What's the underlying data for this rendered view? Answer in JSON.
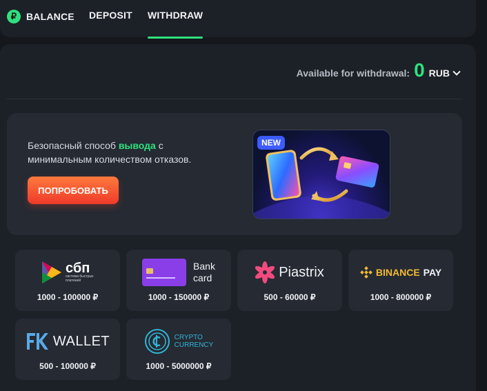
{
  "nav": {
    "logo_symbol": "₽",
    "tabs": [
      {
        "label": "BALANCE"
      },
      {
        "label": "DEPOSIT"
      },
      {
        "label": "WITHDRAW"
      }
    ],
    "active_tab": "WITHDRAW"
  },
  "withdrawal": {
    "available_label": "Available for withdrawal:",
    "amount": "0",
    "currency": "RUB"
  },
  "promo": {
    "text_before": "Безопасный способ ",
    "text_highlight": "вывода",
    "text_after": " с минимальным количеством отказов.",
    "button_label": "ПОПРОБОВАТЬ",
    "badge": "NEW"
  },
  "methods": [
    {
      "name": "сбп",
      "subtitle": "система быстрых платежей",
      "range": "1000 - 100000 ₽"
    },
    {
      "name": "Bank card",
      "line1": "Bank",
      "line2": "card",
      "range": "1000 - 150000 ₽"
    },
    {
      "name": "Piastrix",
      "range": "500 - 60000 ₽"
    },
    {
      "name": "BINANCE PAY",
      "brand": "BINANCE",
      "suffix": "PAY",
      "range": "1000 - 800000 ₽"
    },
    {
      "name": "FK WALLET",
      "brand": "WALLET",
      "range": "500 - 100000 ₽"
    },
    {
      "name": "CRYPTO CURRENCY",
      "line1": "CRYPTO",
      "line2": "CURRENCY",
      "range": "1000 - 5000000 ₽"
    }
  ],
  "colors": {
    "accent": "#2fe17e",
    "button": "#ee3a2a",
    "badge": "#3d5bff",
    "binance": "#f3ba2f"
  }
}
